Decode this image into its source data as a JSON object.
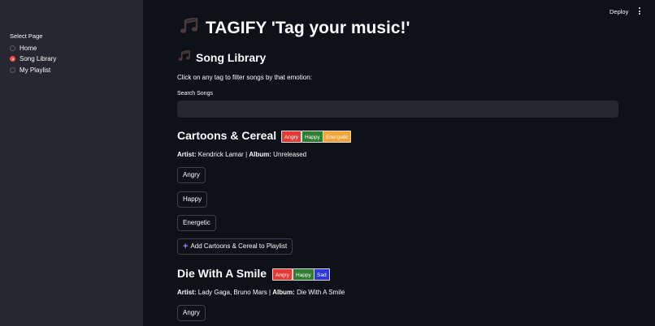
{
  "sidebar": {
    "radio_label": "Select Page",
    "options": [
      "Home",
      "Song Library",
      "My Playlist"
    ],
    "selected": "Song Library"
  },
  "toolbar": {
    "deploy_label": "Deploy",
    "menu_icon": "vertical-dots-icon"
  },
  "main": {
    "title": "TAGIFY 'Tag your music!'",
    "title_icon": "music-notes-icon",
    "section_title": "Song Library",
    "section_icon": "music-notes-icon",
    "hint": "Click on any tag to filter songs by that emotion:",
    "search": {
      "label": "Search Songs",
      "value": "",
      "placeholder": ""
    }
  },
  "songs": [
    {
      "title": "Cartoons & Cereal",
      "tags": [
        {
          "label": "Angry",
          "color": "#e53935"
        },
        {
          "label": "Happy",
          "color": "#2e7d32"
        },
        {
          "label": "Energetic",
          "color": "#f2a33a"
        }
      ],
      "artist_label": "Artist:",
      "artist": "Kendrick Lamar",
      "album_label": "Album:",
      "album": "Unreleased",
      "emotion_buttons": [
        "Angry",
        "Happy",
        "Energetic"
      ],
      "add_button": "Add Cartoons & Cereal to Playlist"
    },
    {
      "title": "Die With A Smile",
      "tags": [
        {
          "label": "Angry",
          "color": "#e53935"
        },
        {
          "label": "Happy",
          "color": "#2e7d32"
        },
        {
          "label": "Sad",
          "color": "#2f37d9"
        }
      ],
      "artist_label": "Artist:",
      "artist": "Lady Gaga, Bruno Mars",
      "album_label": "Album:",
      "album": "Die With A Smile",
      "emotion_buttons": [
        "Angry"
      ]
    }
  ],
  "colors": {
    "background": "#0e1117",
    "sidebar": "#262730",
    "accent": "#ff4b4b"
  }
}
